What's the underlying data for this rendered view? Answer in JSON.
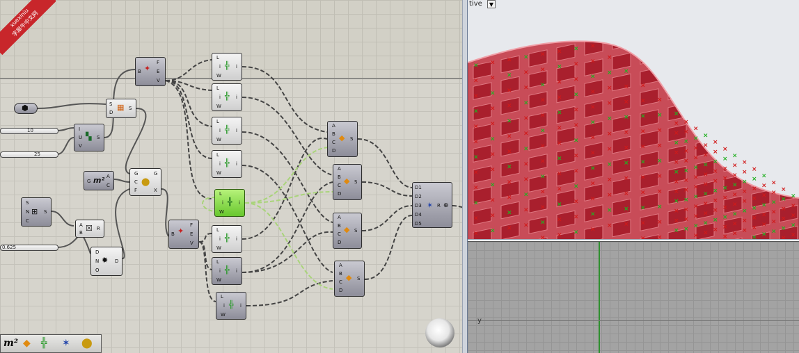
{
  "watermark": {
    "brand": "xuexiniu",
    "chinese": "学犀牛中文网"
  },
  "canvas": {
    "sliders": [
      {
        "value": "10"
      },
      {
        "value": "25"
      },
      {
        "value": "0.625"
      }
    ],
    "components": {
      "explode_top": {
        "pins_in": [
          "B"
        ],
        "pins_out": [
          "F",
          "E",
          "V"
        ]
      },
      "explode_mid": {
        "pins_in": [
          "B"
        ],
        "pins_out": [
          "F",
          "E",
          "V"
        ]
      },
      "surface": {
        "pins_in": [
          "S",
          "D"
        ],
        "pins_out": [
          "S"
        ]
      },
      "divide": {
        "pins_in": [
          "I",
          "U",
          "V"
        ],
        "pins_out": [
          "S"
        ]
      },
      "area": {
        "pins_in": [
          "G"
        ],
        "pins_out": [
          "A",
          "C"
        ],
        "icon_text": "m²"
      },
      "scale": {
        "pins_in": [
          "G",
          "C",
          "F"
        ],
        "pins_out": [
          "G",
          "X"
        ]
      },
      "sub_s": {
        "pins_in": [
          "S",
          "N",
          "C"
        ],
        "pins_out": [
          "S"
        ]
      },
      "multiply": {
        "pins_in": [
          "A",
          "B"
        ],
        "pins_out": [
          "R"
        ]
      },
      "deform": {
        "pins_in": [
          "D",
          "N",
          "O"
        ],
        "pins_out": [
          "D"
        ]
      },
      "weave": {
        "pins_in": [
          "D1",
          "D2",
          "D3",
          "D4",
          "D5"
        ],
        "pins_out": [
          "R"
        ]
      },
      "list_item": {
        "pins_in": [
          "L",
          "i",
          "W"
        ],
        "pins_out": [
          "i"
        ]
      },
      "loft": {
        "pins_in": [
          "A",
          "B",
          "C",
          "D"
        ],
        "pins_out": [
          "S"
        ]
      }
    }
  },
  "toolbar": {
    "area_icon": "m²"
  },
  "viewport_top": {
    "label": "tive",
    "dropdown": "▼"
  },
  "viewport_bottom": {
    "axis_label": "y"
  },
  "colors": {
    "surface_fill": "#c8505a",
    "cell": "#b02030",
    "marker_red": "#d11a1a",
    "marker_green": "#22b022"
  }
}
